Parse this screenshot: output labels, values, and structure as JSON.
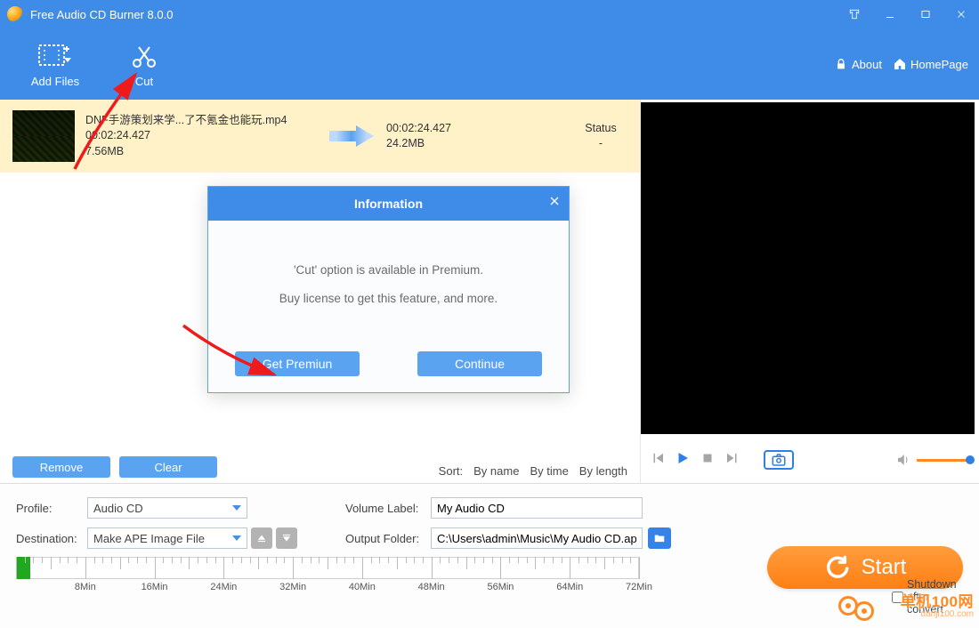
{
  "app": {
    "title": "Free Audio CD Burner 8.0.0"
  },
  "toolbar": {
    "add_files": "Add Files",
    "cut": "Cut",
    "about": "About",
    "homepage": "HomePage"
  },
  "file": {
    "name": "DNF手游策划来学...了不氪金也能玩.mp4",
    "src_duration": "00:02:24.427",
    "src_size": "7.56MB",
    "out_duration": "00:02:24.427",
    "out_size": "24.2MB",
    "status_label": "Status",
    "status_value": "-"
  },
  "list_buttons": {
    "remove": "Remove",
    "clear": "Clear"
  },
  "sort": {
    "label": "Sort:",
    "by_name": "By name",
    "by_time": "By time",
    "by_length": "By length"
  },
  "dialog": {
    "title": "Information",
    "line1": "'Cut' option is available in Premium.",
    "line2": "Buy license to get this feature, and more.",
    "get_premium": "Get Premiun",
    "continue": "Continue"
  },
  "settings": {
    "profile_label": "Profile:",
    "profile_value": "Audio CD",
    "destination_label": "Destination:",
    "destination_value": "Make APE Image File",
    "volume_label_label": "Volume Label:",
    "volume_label_value": "My Audio CD",
    "output_folder_label": "Output Folder:",
    "output_folder_value": "C:\\Users\\admin\\Music\\My Audio CD.ap"
  },
  "timeline_labels": [
    "8Min",
    "16Min",
    "24Min",
    "32Min",
    "40Min",
    "48Min",
    "56Min",
    "64Min",
    "72Min"
  ],
  "start_label": "Start",
  "shutdown_label": "Shutdown after convert",
  "watermark_line1": "单机100网",
  "watermark_line2": "danji100.com"
}
